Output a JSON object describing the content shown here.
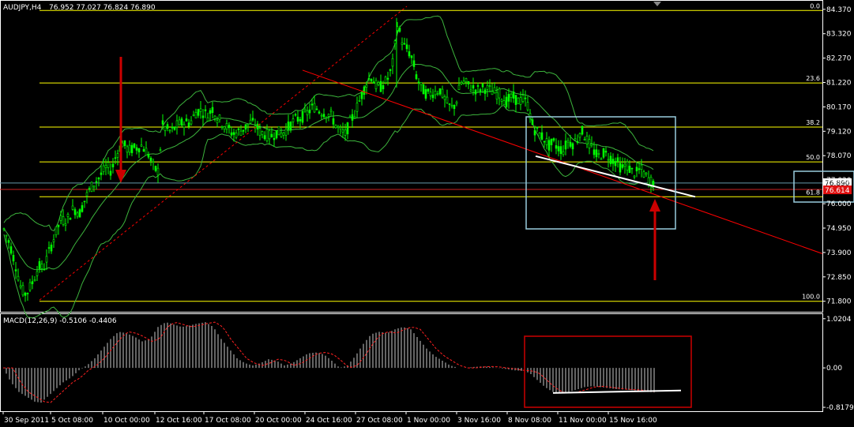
{
  "chart_data": [
    {
      "type": "candlestick",
      "title": "AUDJPY,H4",
      "ohlc": "76.952 77.027 76.824 76.890",
      "price_axis": {
        "ticks": [
          "84.370",
          "83.320",
          "82.270",
          "81.220",
          "80.170",
          "79.120",
          "78.070",
          "77.020",
          "76.000",
          "74.950",
          "73.900",
          "72.850",
          "71.800"
        ],
        "ylim": [
          71.45,
          84.5
        ]
      },
      "x_labels": [
        "30 Sep 2011",
        "5 Oct 08:00",
        "10 Oct 00:00",
        "12 Oct 16:00",
        "17 Oct 08:00",
        "20 Oct 00:00",
        "24 Oct 16:00",
        "27 Oct 08:00",
        "1 Nov 00:00",
        "3 Nov 16:00",
        "8 Nov 08:00",
        "11 Nov 00:00",
        "15 Nov 16:00"
      ],
      "current_price": "76.890",
      "red_label_price": "76.614",
      "fibonacci": {
        "levels": [
          {
            "label": "0.0",
            "price": 84.32
          },
          {
            "label": "23.6",
            "price": 81.2
          },
          {
            "label": "38.2",
            "price": 79.3
          },
          {
            "label": "50.0",
            "price": 77.8
          },
          {
            "label": "61.8",
            "price": 76.3
          },
          {
            "label": "100.0",
            "price": 71.8
          }
        ]
      },
      "close_path": [
        [
          0,
          74.9
        ],
        [
          8,
          74.2
        ],
        [
          16,
          73.2
        ],
        [
          22,
          72.3
        ],
        [
          28,
          72.1
        ],
        [
          36,
          72.6
        ],
        [
          44,
          73.3
        ],
        [
          50,
          73.2
        ],
        [
          56,
          73.8
        ],
        [
          64,
          74.6
        ],
        [
          72,
          75.3
        ],
        [
          80,
          75.3
        ],
        [
          88,
          75.8
        ],
        [
          96,
          75.6
        ],
        [
          104,
          76.3
        ],
        [
          112,
          76.8
        ],
        [
          120,
          77.1
        ],
        [
          124,
          77.3
        ],
        [
          130,
          77.6
        ],
        [
          136,
          77.4
        ],
        [
          142,
          78.1
        ],
        [
          150,
          78.6
        ],
        [
          158,
          78.3
        ],
        [
          166,
          78.4
        ],
        [
          174,
          78.5
        ],
        [
          182,
          78.2
        ],
        [
          190,
          77.5
        ],
        [
          196,
          77.4
        ],
        [
          200,
          79.4
        ],
        [
          206,
          79.2
        ],
        [
          212,
          79.1
        ],
        [
          220,
          79.4
        ],
        [
          228,
          79.5
        ],
        [
          236,
          79.5
        ],
        [
          244,
          80.0
        ],
        [
          250,
          80.0
        ],
        [
          258,
          79.8
        ],
        [
          264,
          80.1
        ],
        [
          270,
          79.7
        ],
        [
          276,
          79.5
        ],
        [
          282,
          79.3
        ],
        [
          290,
          79.0
        ],
        [
          298,
          79.1
        ],
        [
          306,
          79.3
        ],
        [
          312,
          79.5
        ],
        [
          318,
          79.4
        ],
        [
          324,
          79.1
        ],
        [
          330,
          79.0
        ],
        [
          338,
          78.9
        ],
        [
          346,
          79.1
        ],
        [
          352,
          79.0
        ],
        [
          360,
          79.3
        ],
        [
          368,
          79.6
        ],
        [
          376,
          79.7
        ],
        [
          384,
          79.9
        ],
        [
          392,
          80.2
        ],
        [
          400,
          80.0
        ],
        [
          408,
          79.9
        ],
        [
          414,
          79.8
        ],
        [
          420,
          79.4
        ],
        [
          426,
          79.1
        ],
        [
          432,
          79.0
        ],
        [
          438,
          79.5
        ],
        [
          444,
          79.9
        ],
        [
          452,
          80.6
        ],
        [
          460,
          81.3
        ],
        [
          466,
          81.5
        ],
        [
          470,
          81.1
        ],
        [
          476,
          81.0
        ],
        [
          482,
          81.2
        ],
        [
          488,
          81.5
        ],
        [
          494,
          82.3
        ],
        [
          497,
          83.8
        ],
        [
          500,
          83.5
        ],
        [
          506,
          82.8
        ],
        [
          512,
          82.6
        ],
        [
          518,
          82.1
        ],
        [
          522,
          81.5
        ],
        [
          528,
          81.0
        ],
        [
          536,
          80.7
        ],
        [
          544,
          80.8
        ],
        [
          552,
          80.9
        ],
        [
          558,
          80.5
        ],
        [
          566,
          80.1
        ],
        [
          572,
          80.3
        ],
        [
          578,
          81.2
        ],
        [
          584,
          81.2
        ],
        [
          592,
          81.0
        ],
        [
          600,
          80.9
        ],
        [
          608,
          81.0
        ],
        [
          614,
          80.9
        ],
        [
          620,
          80.8
        ],
        [
          628,
          80.7
        ],
        [
          636,
          80.4
        ],
        [
          644,
          80.6
        ],
        [
          652,
          80.4
        ],
        [
          658,
          80.5
        ],
        [
          664,
          80.2
        ],
        [
          668,
          79.5
        ],
        [
          672,
          79.2
        ],
        [
          678,
          79.0
        ],
        [
          684,
          78.8
        ],
        [
          690,
          78.5
        ],
        [
          696,
          78.6
        ],
        [
          702,
          78.4
        ],
        [
          708,
          78.3
        ],
        [
          714,
          78.7
        ],
        [
          720,
          78.6
        ],
        [
          726,
          78.8
        ],
        [
          730,
          79.2
        ],
        [
          734,
          79.0
        ],
        [
          740,
          78.6
        ],
        [
          746,
          78.3
        ],
        [
          752,
          78.0
        ],
        [
          758,
          78.2
        ],
        [
          764,
          78.1
        ],
        [
          770,
          77.9
        ],
        [
          776,
          77.8
        ],
        [
          782,
          77.5
        ],
        [
          788,
          77.7
        ],
        [
          794,
          77.4
        ],
        [
          800,
          77.3
        ],
        [
          806,
          77.5
        ],
        [
          812,
          77.2
        ],
        [
          818,
          77.0
        ],
        [
          824,
          76.9
        ]
      ]
    },
    {
      "type": "bar",
      "title": "MACD(12,26,9) -0.5106 -0.4406",
      "axis": {
        "ticks": [
          "1.0204",
          "0.00",
          "-0.8179"
        ],
        "ylim": [
          -0.85,
          1.05
        ]
      },
      "macd_path": [
        [
          0,
          0
        ],
        [
          10,
          -0.3
        ],
        [
          20,
          -0.5
        ],
        [
          30,
          -0.6
        ],
        [
          40,
          -0.7
        ],
        [
          48,
          -0.72
        ],
        [
          56,
          -0.6
        ],
        [
          66,
          -0.45
        ],
        [
          76,
          -0.3
        ],
        [
          86,
          -0.2
        ],
        [
          96,
          -0.05
        ],
        [
          106,
          0.05
        ],
        [
          116,
          0.2
        ],
        [
          126,
          0.4
        ],
        [
          136,
          0.6
        ],
        [
          146,
          0.75
        ],
        [
          156,
          0.72
        ],
        [
          166,
          0.65
        ],
        [
          176,
          0.55
        ],
        [
          186,
          0.6
        ],
        [
          196,
          0.85
        ],
        [
          206,
          0.95
        ],
        [
          216,
          0.9
        ],
        [
          226,
          0.85
        ],
        [
          236,
          0.88
        ],
        [
          246,
          0.92
        ],
        [
          256,
          0.95
        ],
        [
          266,
          0.85
        ],
        [
          276,
          0.6
        ],
        [
          286,
          0.4
        ],
        [
          296,
          0.2
        ],
        [
          306,
          0.1
        ],
        [
          316,
          0.05
        ],
        [
          326,
          0.1
        ],
        [
          336,
          0.18
        ],
        [
          346,
          0.15
        ],
        [
          356,
          0.05
        ],
        [
          366,
          0.1
        ],
        [
          376,
          0.2
        ],
        [
          386,
          0.3
        ],
        [
          396,
          0.32
        ],
        [
          406,
          0.28
        ],
        [
          416,
          0.15
        ],
        [
          426,
          0.0
        ],
        [
          436,
          0.05
        ],
        [
          446,
          0.25
        ],
        [
          456,
          0.5
        ],
        [
          466,
          0.7
        ],
        [
          476,
          0.75
        ],
        [
          486,
          0.72
        ],
        [
          496,
          0.8
        ],
        [
          506,
          0.85
        ],
        [
          516,
          0.8
        ],
        [
          526,
          0.6
        ],
        [
          536,
          0.4
        ],
        [
          546,
          0.25
        ],
        [
          556,
          0.15
        ],
        [
          566,
          0.05
        ],
        [
          576,
          0.0
        ],
        [
          586,
          0.0
        ],
        [
          596,
          0.02
        ],
        [
          606,
          0.03
        ],
        [
          616,
          0.02
        ],
        [
          626,
          0.0
        ],
        [
          636,
          -0.02
        ],
        [
          646,
          -0.05
        ],
        [
          656,
          -0.06
        ],
        [
          666,
          -0.1
        ],
        [
          676,
          -0.25
        ],
        [
          686,
          -0.4
        ],
        [
          696,
          -0.5
        ],
        [
          706,
          -0.52
        ],
        [
          716,
          -0.5
        ],
        [
          726,
          -0.45
        ],
        [
          736,
          -0.4
        ],
        [
          746,
          -0.38
        ],
        [
          756,
          -0.4
        ],
        [
          766,
          -0.42
        ],
        [
          776,
          -0.44
        ],
        [
          786,
          -0.45
        ],
        [
          796,
          -0.46
        ],
        [
          806,
          -0.48
        ],
        [
          816,
          -0.5
        ],
        [
          826,
          -0.51
        ]
      ]
    }
  ],
  "colors": {
    "bull": "#00ff00",
    "bear": "#00cc00",
    "fib": "#ffff00",
    "trend": "#ff0000",
    "bands": "#3cb33c",
    "box": "#99ccdd",
    "macd_box": "#cc0000",
    "arrow": "#cc0000",
    "grid": "#ffffff"
  }
}
